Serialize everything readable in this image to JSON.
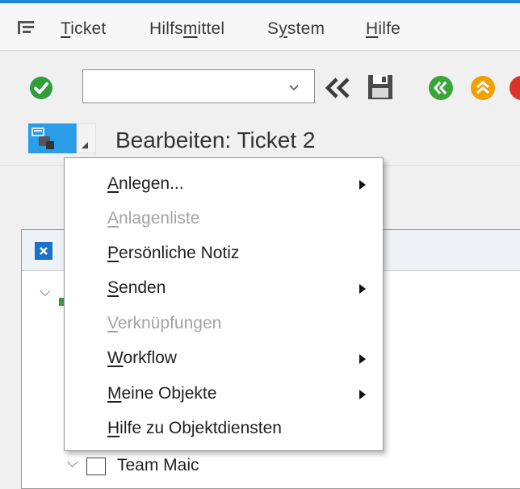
{
  "menubar": {
    "items": [
      {
        "pre": "",
        "key": "T",
        "post": "icket"
      },
      {
        "pre": "Hilfs",
        "key": "m",
        "post": "ittel"
      },
      {
        "pre": "S",
        "key": "y",
        "post": "stem"
      },
      {
        "pre": "",
        "key": "H",
        "post": "ilfe"
      }
    ]
  },
  "toolbar": {
    "command_value": ""
  },
  "header": {
    "title": "Bearbeiten: Ticket 2"
  },
  "tree": {
    "visible_node_label": "Team Maic"
  },
  "context_menu": {
    "items": [
      {
        "pre": "",
        "key": "A",
        "post": "nlegen...",
        "enabled": true,
        "submenu": true
      },
      {
        "pre": "",
        "key": "A",
        "post": "nlagenliste",
        "enabled": false,
        "submenu": false
      },
      {
        "pre": "",
        "key": "P",
        "post": "ersönliche Notiz",
        "enabled": true,
        "submenu": false
      },
      {
        "pre": "",
        "key": "S",
        "post": "enden",
        "enabled": true,
        "submenu": true
      },
      {
        "pre": "",
        "key": "V",
        "post": "erknüpfungen",
        "enabled": false,
        "submenu": false
      },
      {
        "pre": "",
        "key": "W",
        "post": "orkflow",
        "enabled": true,
        "submenu": true
      },
      {
        "pre": "",
        "key": "M",
        "post": "eine Objekte",
        "enabled": true,
        "submenu": true
      },
      {
        "pre": "",
        "key": "H",
        "post": "ilfe zu Objektdiensten",
        "enabled": true,
        "submenu": false
      }
    ]
  },
  "colors": {
    "accent": "#1e88d8",
    "ok_green": "#2e9d3a",
    "nav_green": "#3aa63a",
    "nav_orange": "#f0a000",
    "nav_red": "#e0302a",
    "disabled_text": "#a3a3a3"
  },
  "icons": {
    "menu": "menu-toggle-icon",
    "ok": "checkmark-icon",
    "back": "double-chevron-left-icon",
    "save": "floppy-disk-icon",
    "exit": "double-chevron-left-round-icon",
    "cancel_up": "double-chevron-up-round-icon",
    "object_services": "object-services-icon",
    "close": "close-icon"
  }
}
